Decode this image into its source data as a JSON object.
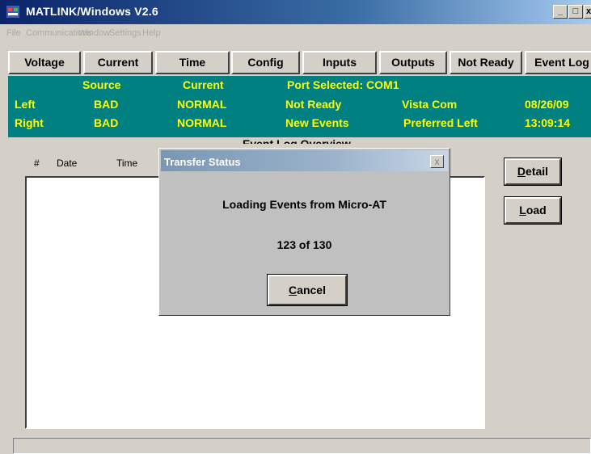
{
  "window": {
    "title": "MATLINK/Windows V2.6",
    "controls": {
      "minimize": "_",
      "maximize": "□",
      "close": "x"
    }
  },
  "menu": [
    "File",
    "Communications",
    "Window",
    "Settings",
    "Help"
  ],
  "tabs": [
    "Voltage",
    "Current",
    "Time",
    "Config",
    "Inputs",
    "Outputs",
    "Not Ready",
    "Event Log"
  ],
  "status": {
    "header_source": "Source",
    "header_current": "Current",
    "port": "Port Selected: COM1",
    "left_label": "Left",
    "left_source": "BAD",
    "left_current": "NORMAL",
    "left_status": "Not Ready",
    "left_info": "Vista Com",
    "date": "08/26/09",
    "right_label": "Right",
    "right_source": "BAD",
    "right_current": "NORMAL",
    "right_status": "New Events",
    "right_info": "Preferred Left",
    "time": "13:09:14",
    "colors": {
      "panel": "#008080",
      "text": "#ffff00"
    }
  },
  "event_log": {
    "caption": "Event Log Overview",
    "columns": [
      "#",
      "Date",
      "Time"
    ]
  },
  "side_buttons": {
    "detail_mnemonic": "D",
    "detail_rest": "etail",
    "load_mnemonic": "L",
    "load_rest": "oad"
  },
  "dialog": {
    "title": "Transfer Status",
    "close": "x",
    "message": "Loading Events from Micro-AT",
    "progress": "123 of 130",
    "progress_current": 123,
    "progress_total": 130,
    "cancel_mnemonic": "C",
    "cancel_rest": "ancel"
  },
  "icons": {
    "app": "app-icon"
  }
}
